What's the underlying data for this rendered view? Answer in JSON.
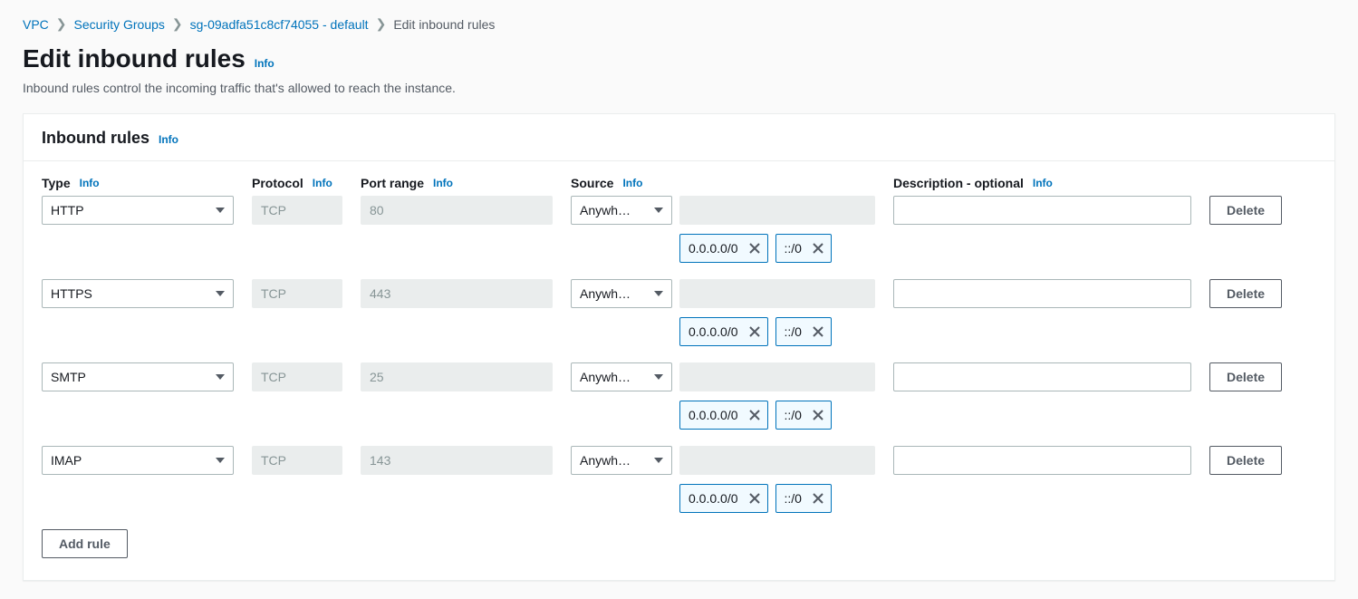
{
  "breadcrumb": {
    "items": [
      {
        "label": "VPC"
      },
      {
        "label": "Security Groups"
      },
      {
        "label": "sg-09adfa51c8cf74055 - default"
      }
    ],
    "current": "Edit inbound rules"
  },
  "page": {
    "title": "Edit inbound rules",
    "info": "Info",
    "description": "Inbound rules control the incoming traffic that's allowed to reach the instance."
  },
  "panel": {
    "title": "Inbound rules",
    "info": "Info"
  },
  "columns": {
    "type": "Type",
    "protocol": "Protocol",
    "port": "Port range",
    "source": "Source",
    "description": "Description - optional",
    "info": "Info"
  },
  "rules": [
    {
      "type": "HTTP",
      "protocol": "TCP",
      "port": "80",
      "sourceSelect": "Anywh…",
      "chips": [
        "0.0.0.0/0",
        "::/0"
      ],
      "description": ""
    },
    {
      "type": "HTTPS",
      "protocol": "TCP",
      "port": "443",
      "sourceSelect": "Anywh…",
      "chips": [
        "0.0.0.0/0",
        "::/0"
      ],
      "description": ""
    },
    {
      "type": "SMTP",
      "protocol": "TCP",
      "port": "25",
      "sourceSelect": "Anywh…",
      "chips": [
        "0.0.0.0/0",
        "::/0"
      ],
      "description": ""
    },
    {
      "type": "IMAP",
      "protocol": "TCP",
      "port": "143",
      "sourceSelect": "Anywh…",
      "chips": [
        "0.0.0.0/0",
        "::/0"
      ],
      "description": ""
    }
  ],
  "actions": {
    "delete": "Delete",
    "addRule": "Add rule"
  }
}
